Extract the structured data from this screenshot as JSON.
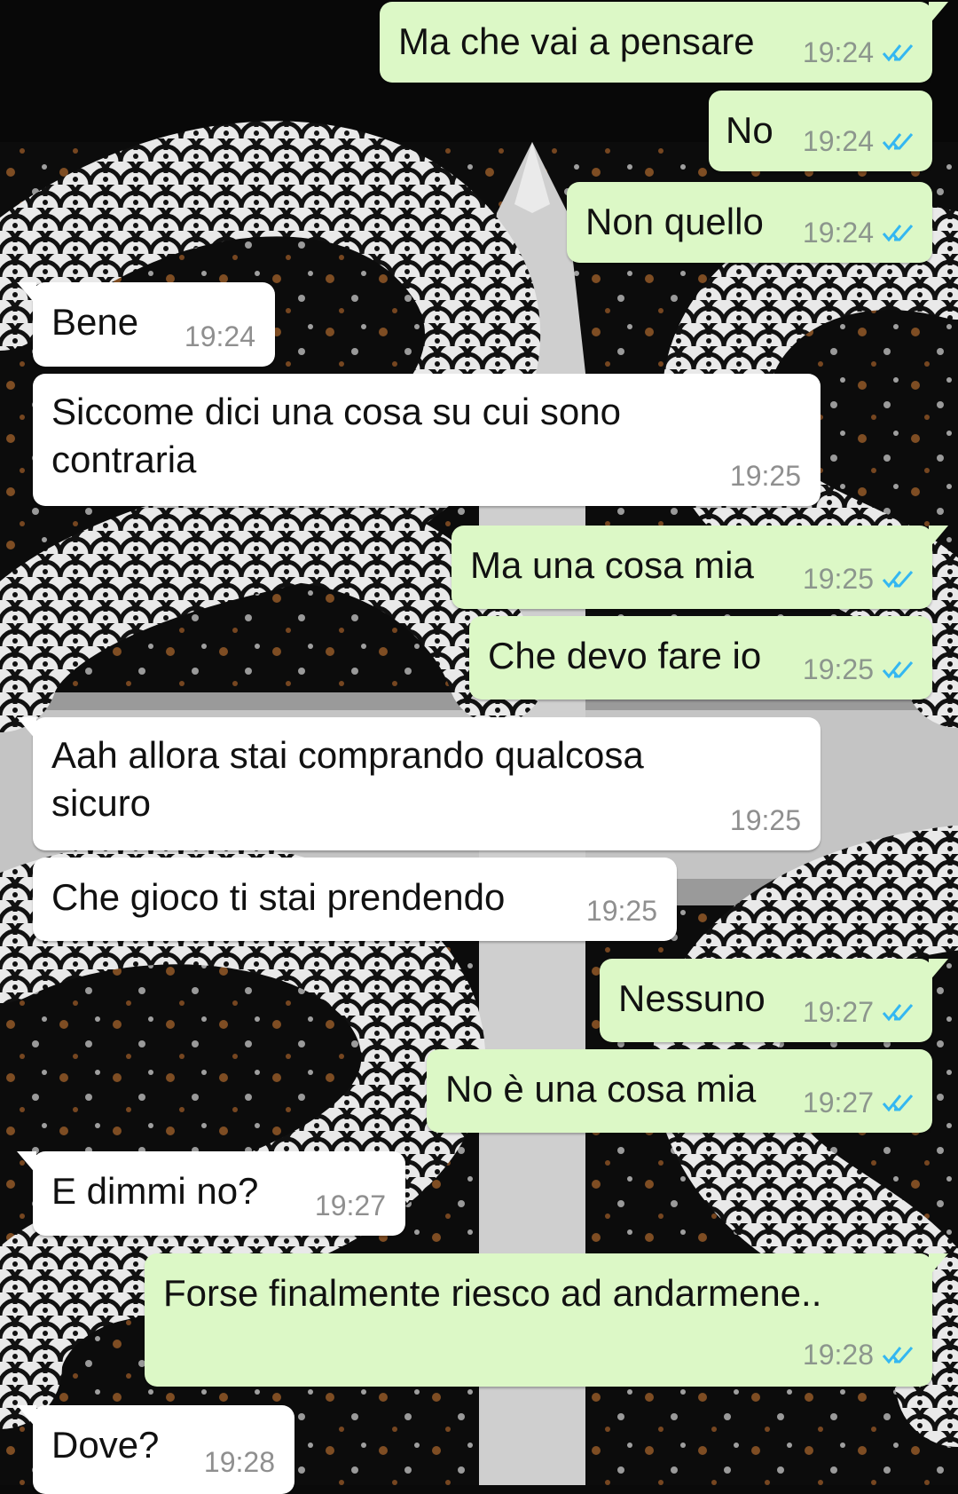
{
  "colors": {
    "outgoing_bubble": "#dcf8c6",
    "incoming_bubble": "#ffffff",
    "read_ticks": "#34b7f1",
    "timestamp": "#8c968d"
  },
  "icons": {
    "read_receipt": "double-check-icon"
  },
  "messages": [
    {
      "dir": "out",
      "text": "Ma che vai a pensare",
      "time": "19:24",
      "status": "read"
    },
    {
      "dir": "out",
      "text": "No",
      "time": "19:24",
      "status": "read"
    },
    {
      "dir": "out",
      "text": "Non quello",
      "time": "19:24",
      "status": "read"
    },
    {
      "dir": "in",
      "text": "Bene",
      "time": "19:24"
    },
    {
      "dir": "in",
      "line1": "Siccome dici una cosa su cui sono",
      "line2": "contraria",
      "time": "19:25"
    },
    {
      "dir": "out",
      "text": "Ma una cosa mia",
      "time": "19:25",
      "status": "read"
    },
    {
      "dir": "out",
      "text": "Che devo fare io",
      "time": "19:25",
      "status": "read"
    },
    {
      "dir": "in",
      "line1": "Aah allora stai comprando qualcosa",
      "line2": "sicuro",
      "time": "19:25"
    },
    {
      "dir": "in",
      "text": "Che gioco ti stai prendendo",
      "time": "19:25"
    },
    {
      "dir": "out",
      "text": "Nessuno",
      "time": "19:27",
      "status": "read"
    },
    {
      "dir": "out",
      "text": "No è una cosa mia",
      "time": "19:27",
      "status": "read"
    },
    {
      "dir": "in",
      "text": "E dimmi no?",
      "time": "19:27"
    },
    {
      "dir": "out",
      "text": "Forse finalmente riesco ad andarmene..",
      "time": "19:28",
      "status": "read"
    },
    {
      "dir": "in",
      "text": "Dove?",
      "time": "19:28"
    }
  ]
}
